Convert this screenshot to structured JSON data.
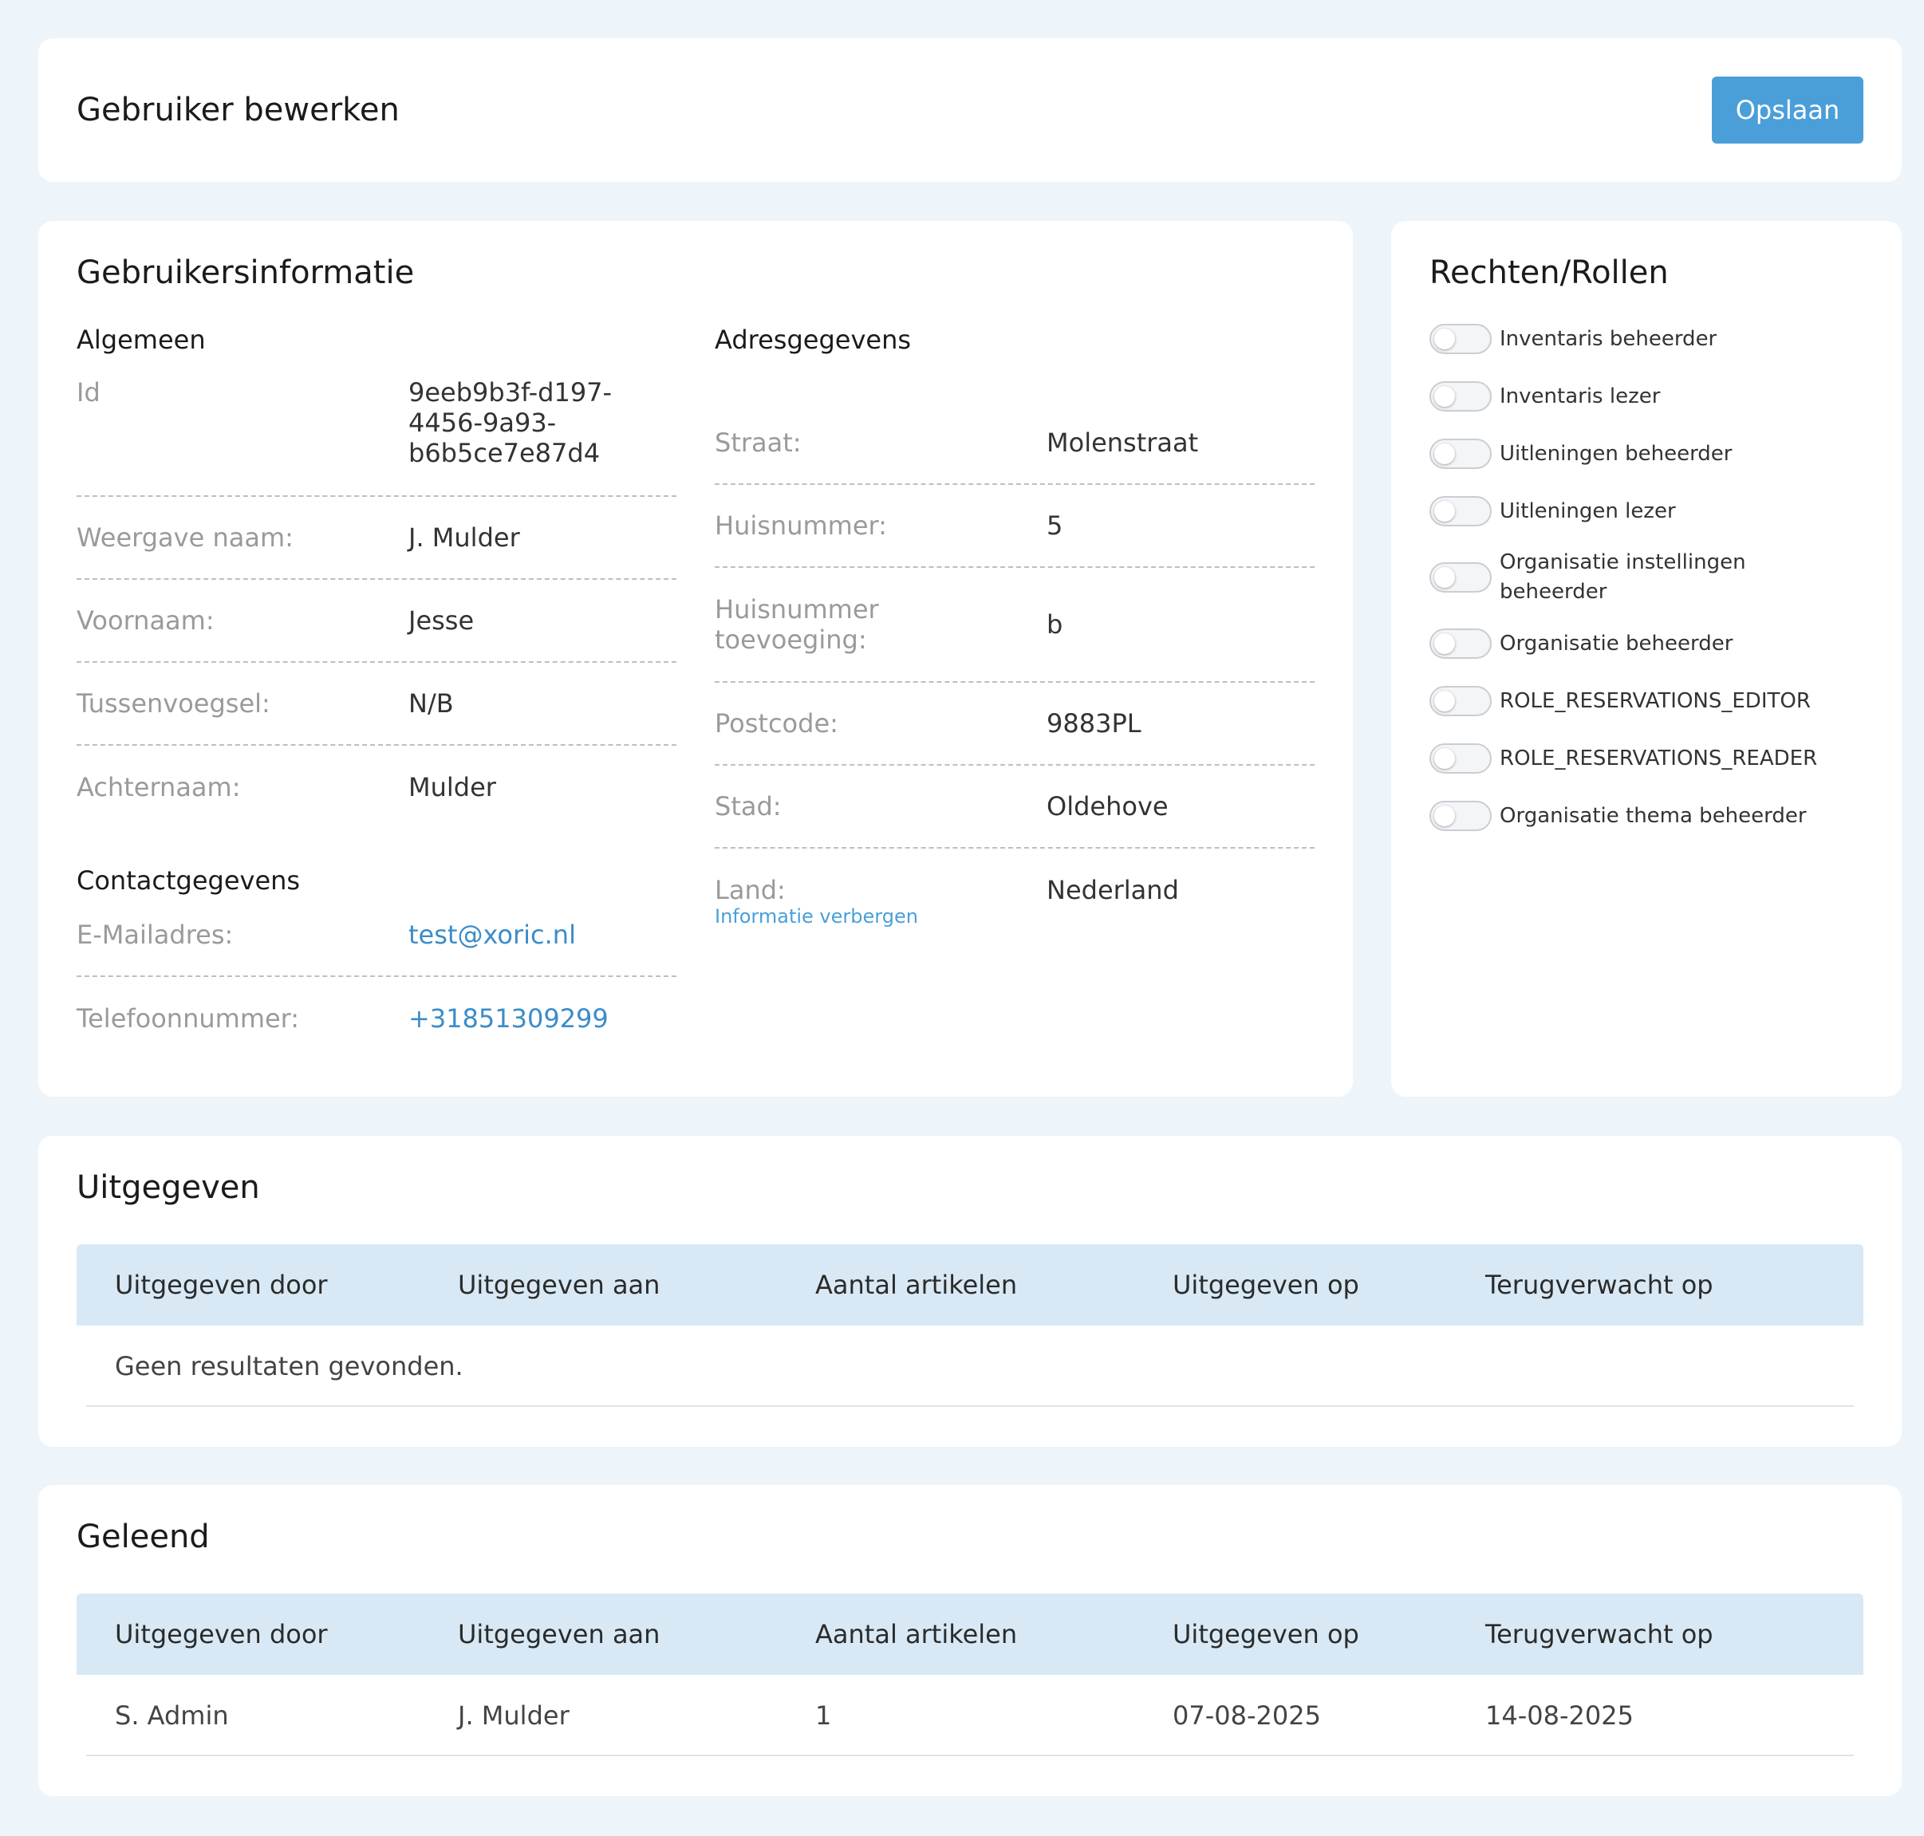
{
  "header": {
    "title": "Gebruiker bewerken",
    "save_label": "Opslaan"
  },
  "user_info": {
    "title": "Gebruikersinformatie",
    "general": {
      "title": "Algemeen",
      "id_label": "Id",
      "id_lines": [
        "9eeb9b3f-d197-",
        "4456-9a93-",
        "b6b5ce7e87d4"
      ],
      "display_name_label": "Weergave naam:",
      "display_name": "J. Mulder",
      "first_name_label": "Voornaam:",
      "first_name": "Jesse",
      "infix_label": "Tussenvoegsel:",
      "infix": "N/B",
      "last_name_label": "Achternaam:",
      "last_name": "Mulder"
    },
    "contact": {
      "title": "Contactgegevens",
      "email_label": "E-Mailadres:",
      "email": "test@xoric.nl",
      "phone_label": "Telefoonnummer:",
      "phone": "+31851309299"
    },
    "address": {
      "title": "Adresgegevens",
      "street_label": "Straat:",
      "street": "Molenstraat",
      "house_number_label": "Huisnummer:",
      "house_number": "5",
      "addition_label_lines": [
        "Huisnummer",
        "toevoeging:"
      ],
      "addition": "b",
      "postal_code_label": "Postcode:",
      "postal_code": "9883PL",
      "city_label": "Stad:",
      "city": "Oldehove",
      "country_label": "Land:",
      "country": "Nederland",
      "hide_link": "Informatie verbergen"
    }
  },
  "roles": {
    "title": "Rechten/Rollen",
    "items": [
      {
        "label_lines": [
          "Inventaris beheerder"
        ],
        "enabled": false
      },
      {
        "label_lines": [
          "Inventaris lezer"
        ],
        "enabled": false
      },
      {
        "label_lines": [
          "Uitleningen beheerder"
        ],
        "enabled": false
      },
      {
        "label_lines": [
          "Uitleningen lezer"
        ],
        "enabled": false
      },
      {
        "label_lines": [
          "Organisatie instellingen",
          "beheerder"
        ],
        "enabled": false
      },
      {
        "label_lines": [
          "Organisatie beheerder"
        ],
        "enabled": false
      },
      {
        "label_lines": [
          "ROLE_RESERVATIONS_EDITOR"
        ],
        "enabled": false
      },
      {
        "label_lines": [
          "ROLE_RESERVATIONS_READER"
        ],
        "enabled": false
      },
      {
        "label_lines": [
          "Organisatie thema beheerder"
        ],
        "enabled": false
      }
    ]
  },
  "issued": {
    "title": "Uitgegeven",
    "columns": [
      "Uitgegeven door",
      "Uitgegeven aan",
      "Aantal artikelen",
      "Uitgegeven op",
      "Terugverwacht op"
    ],
    "empty_text": "Geen resultaten gevonden."
  },
  "borrowed": {
    "title": "Geleend",
    "columns": [
      "Uitgegeven door",
      "Uitgegeven aan",
      "Aantal artikelen",
      "Uitgegeven op",
      "Terugverwacht op"
    ],
    "rows": [
      [
        "S. Admin",
        "J. Mulder",
        "1",
        "07-08-2025",
        "14-08-2025"
      ]
    ]
  },
  "colors": {
    "accent": "#4a9fd9",
    "background": "#edf4fa",
    "table_header": "#d8e9f5"
  }
}
